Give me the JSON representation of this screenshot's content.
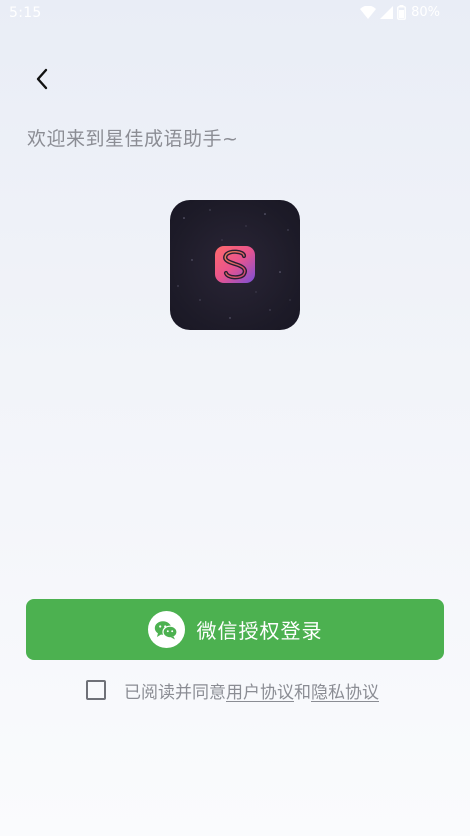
{
  "status_bar": {
    "time": "5:15",
    "battery": "80%"
  },
  "header": {
    "welcome_text": "欢迎来到星佳成语助手~"
  },
  "login": {
    "button_label": "微信授权登录"
  },
  "agreement": {
    "prefix": "已阅读并同意",
    "user_agreement": "用户协议",
    "and": "和",
    "privacy_policy": "隐私协议"
  },
  "colors": {
    "primary_green": "#4cb150",
    "muted_text": "#8b8d94"
  },
  "icons": {
    "back": "chevron-left-icon",
    "wechat": "wechat-icon",
    "wifi": "wifi-icon",
    "signal": "signal-icon",
    "battery": "battery-icon"
  }
}
